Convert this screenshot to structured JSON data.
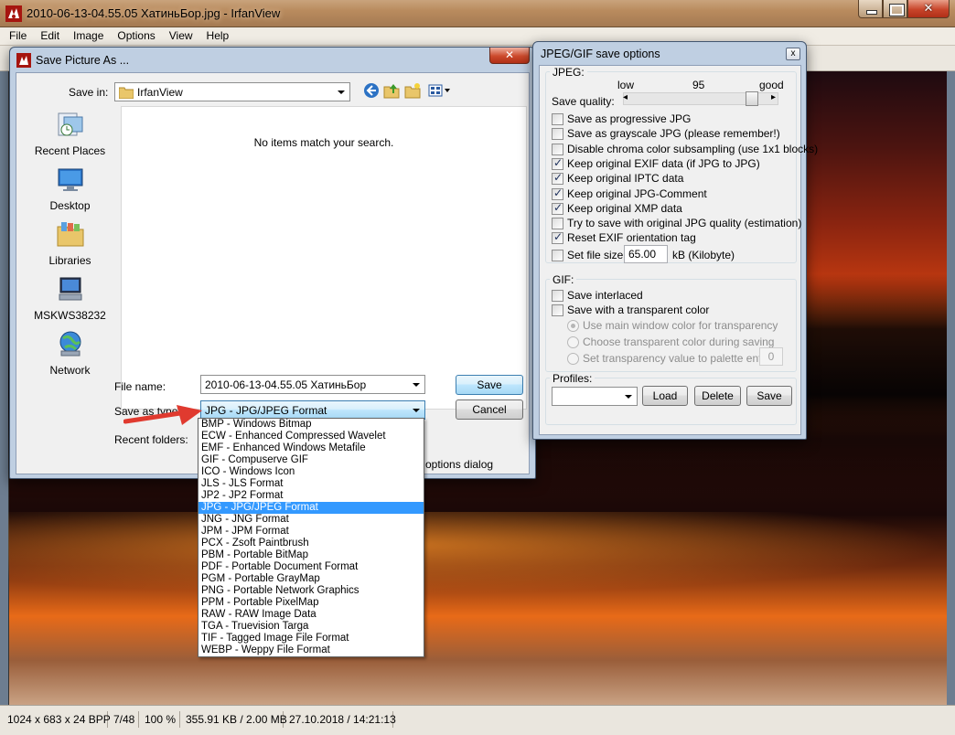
{
  "window": {
    "title": "2010-06-13-04.55.05 ХатиньБор.jpg - IrfanView",
    "menu": [
      "File",
      "Edit",
      "Image",
      "Options",
      "View",
      "Help"
    ]
  },
  "status": {
    "dims": "1024 x 683 x 24 BPP",
    "index": "7/48",
    "zoom": "100 %",
    "size": "355.91 KB / 2.00 MB",
    "datetime": "27.10.2018 / 14:21:13"
  },
  "save_dialog": {
    "title": "Save Picture As ...",
    "save_in_label": "Save in:",
    "save_in_value": "IrfanView",
    "places": [
      "Recent Places",
      "Desktop",
      "Libraries",
      "MSKWS38232",
      "Network"
    ],
    "empty_message": "No items match your search.",
    "file_name_label": "File name:",
    "file_name_value": "2010-06-13-04.55.05 ХатиньБор",
    "save_as_type_label": "Save as type:",
    "save_as_type_value": "JPG - JPG/JPEG Format",
    "recent_folders_label": "Recent folders:",
    "options_dialog_partial": "options dialog",
    "save_button": "Save",
    "cancel_button": "Cancel",
    "type_options": [
      "BMP - Windows Bitmap",
      "ECW - Enhanced Compressed Wavelet",
      "EMF - Enhanced Windows Metafile",
      "GIF - Compuserve GIF",
      "ICO - Windows Icon",
      "JLS - JLS Format",
      "JP2 - JP2 Format",
      "JPG - JPG/JPEG Format",
      "JNG - JNG Format",
      "JPM - JPM Format",
      "PCX - Zsoft Paintbrush",
      "PBM - Portable BitMap",
      "PDF - Portable Document Format",
      "PGM - Portable GrayMap",
      "PNG - Portable Network Graphics",
      "PPM - Portable PixelMap",
      "RAW - RAW Image Data",
      "TGA - Truevision Targa",
      "TIF - Tagged Image File Format",
      "WEBP - Weppy File Format"
    ],
    "selected_type_index": 7
  },
  "jpg_dialog": {
    "title": "JPEG/GIF save options",
    "close_glyph": "x",
    "jpeg_group": "JPEG:",
    "low": "low",
    "good": "good",
    "quality_value": "95",
    "quality_label": "Save quality:",
    "slider_left": "◂",
    "slider_right": "▸",
    "jpeg_options": [
      {
        "label": "Save as progressive JPG",
        "checked": false
      },
      {
        "label": "Save as grayscale JPG (please remember!)",
        "checked": false
      },
      {
        "label": "Disable chroma color subsampling (use 1x1 blocks)",
        "checked": false
      },
      {
        "label": "Keep original EXIF data (if JPG to JPG)",
        "checked": true
      },
      {
        "label": "Keep original IPTC data",
        "checked": true
      },
      {
        "label": "Keep original JPG-Comment",
        "checked": true
      },
      {
        "label": "Keep original XMP data",
        "checked": true
      },
      {
        "label": "Try to save with original JPG quality (estimation)",
        "checked": false
      },
      {
        "label": "Reset EXIF orientation tag",
        "checked": true
      }
    ],
    "set_file_size_label": "Set file size:",
    "set_file_size_checked": false,
    "file_size_value": "65.00",
    "file_size_unit": "kB (Kilobyte)",
    "gif_group": "GIF:",
    "gif_options": [
      {
        "label": "Save interlaced",
        "checked": false
      },
      {
        "label": "Save with a transparent color",
        "checked": false
      }
    ],
    "transparency_options": [
      {
        "label": "Use main window color for transparency",
        "selected": true
      },
      {
        "label": "Choose transparent color during saving",
        "selected": false
      },
      {
        "label": "Set transparency value to palette entry:",
        "selected": false
      }
    ],
    "palette_entry_value": "0",
    "profiles_group": "Profiles:",
    "profile_value": "",
    "load_button": "Load",
    "delete_button": "Delete",
    "save_button": "Save"
  },
  "colors": {
    "accent_arrow": "#e03a2f",
    "selection_blue": "#3399ff"
  }
}
